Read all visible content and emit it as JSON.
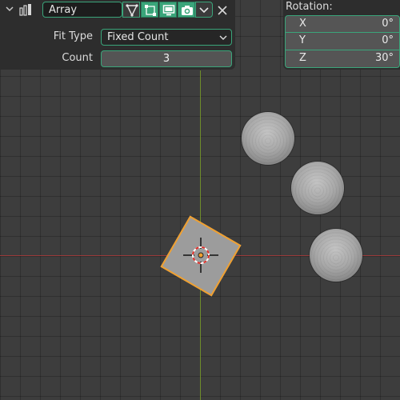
{
  "modifier": {
    "name": "Array",
    "fit_type_label": "Fit Type",
    "fit_type_value": "Fixed Count",
    "count_label": "Count",
    "count_value": "3",
    "icons": {
      "collapse": "chevron-down-icon",
      "type": "array-modifier-icon",
      "edit_mode": "edit-mode-icon",
      "on_cage": "on-cage-icon",
      "viewport": "monitor-icon",
      "render": "camera-icon",
      "dropdown": "chevron-down-icon",
      "close": "close-icon"
    }
  },
  "rotation": {
    "title": "Rotation:",
    "fields": [
      {
        "axis": "X",
        "value": "0°"
      },
      {
        "axis": "Y",
        "value": "0°"
      },
      {
        "axis": "Z",
        "value": "30°"
      }
    ]
  },
  "colors": {
    "accent": "#3aa57a",
    "selection_outline": "#f0a030",
    "x_axis": "#9a3a3a",
    "y_axis": "#6f8d2a",
    "background": "#3d3d3d"
  }
}
